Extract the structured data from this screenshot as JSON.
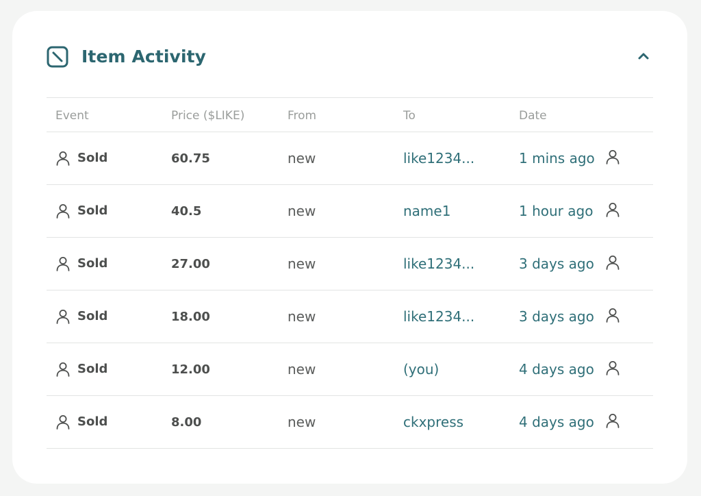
{
  "panel": {
    "title": "Item Activity",
    "icon": "item-activity-icon",
    "collapse_icon": "chevron-up-icon"
  },
  "table": {
    "columns": [
      "Event",
      "Price ($LIKE)",
      "From",
      "To",
      "Date"
    ],
    "rows": [
      {
        "event": "Sold",
        "price": "60.75",
        "from": "new",
        "to": "like1234...",
        "date": "1 mins ago"
      },
      {
        "event": "Sold",
        "price": "40.5",
        "from": "new",
        "to": "name1",
        "date": "1 hour ago"
      },
      {
        "event": "Sold",
        "price": "27.00",
        "from": "new",
        "to": "like1234...",
        "date": "3 days ago"
      },
      {
        "event": "Sold",
        "price": "18.00",
        "from": "new",
        "to": "like1234...",
        "date": "3 days ago"
      },
      {
        "event": "Sold",
        "price": "12.00",
        "from": "new",
        "to": "(you)",
        "date": "4 days ago"
      },
      {
        "event": "Sold",
        "price": "8.00",
        "from": "new",
        "to": "ckxpress",
        "date": "4 days ago"
      }
    ]
  },
  "colors": {
    "accent": "#2c6670",
    "link": "#2f6f78",
    "muted": "#9a9d9b",
    "text": "#4d4f4e",
    "background": "#f4f5f4"
  }
}
